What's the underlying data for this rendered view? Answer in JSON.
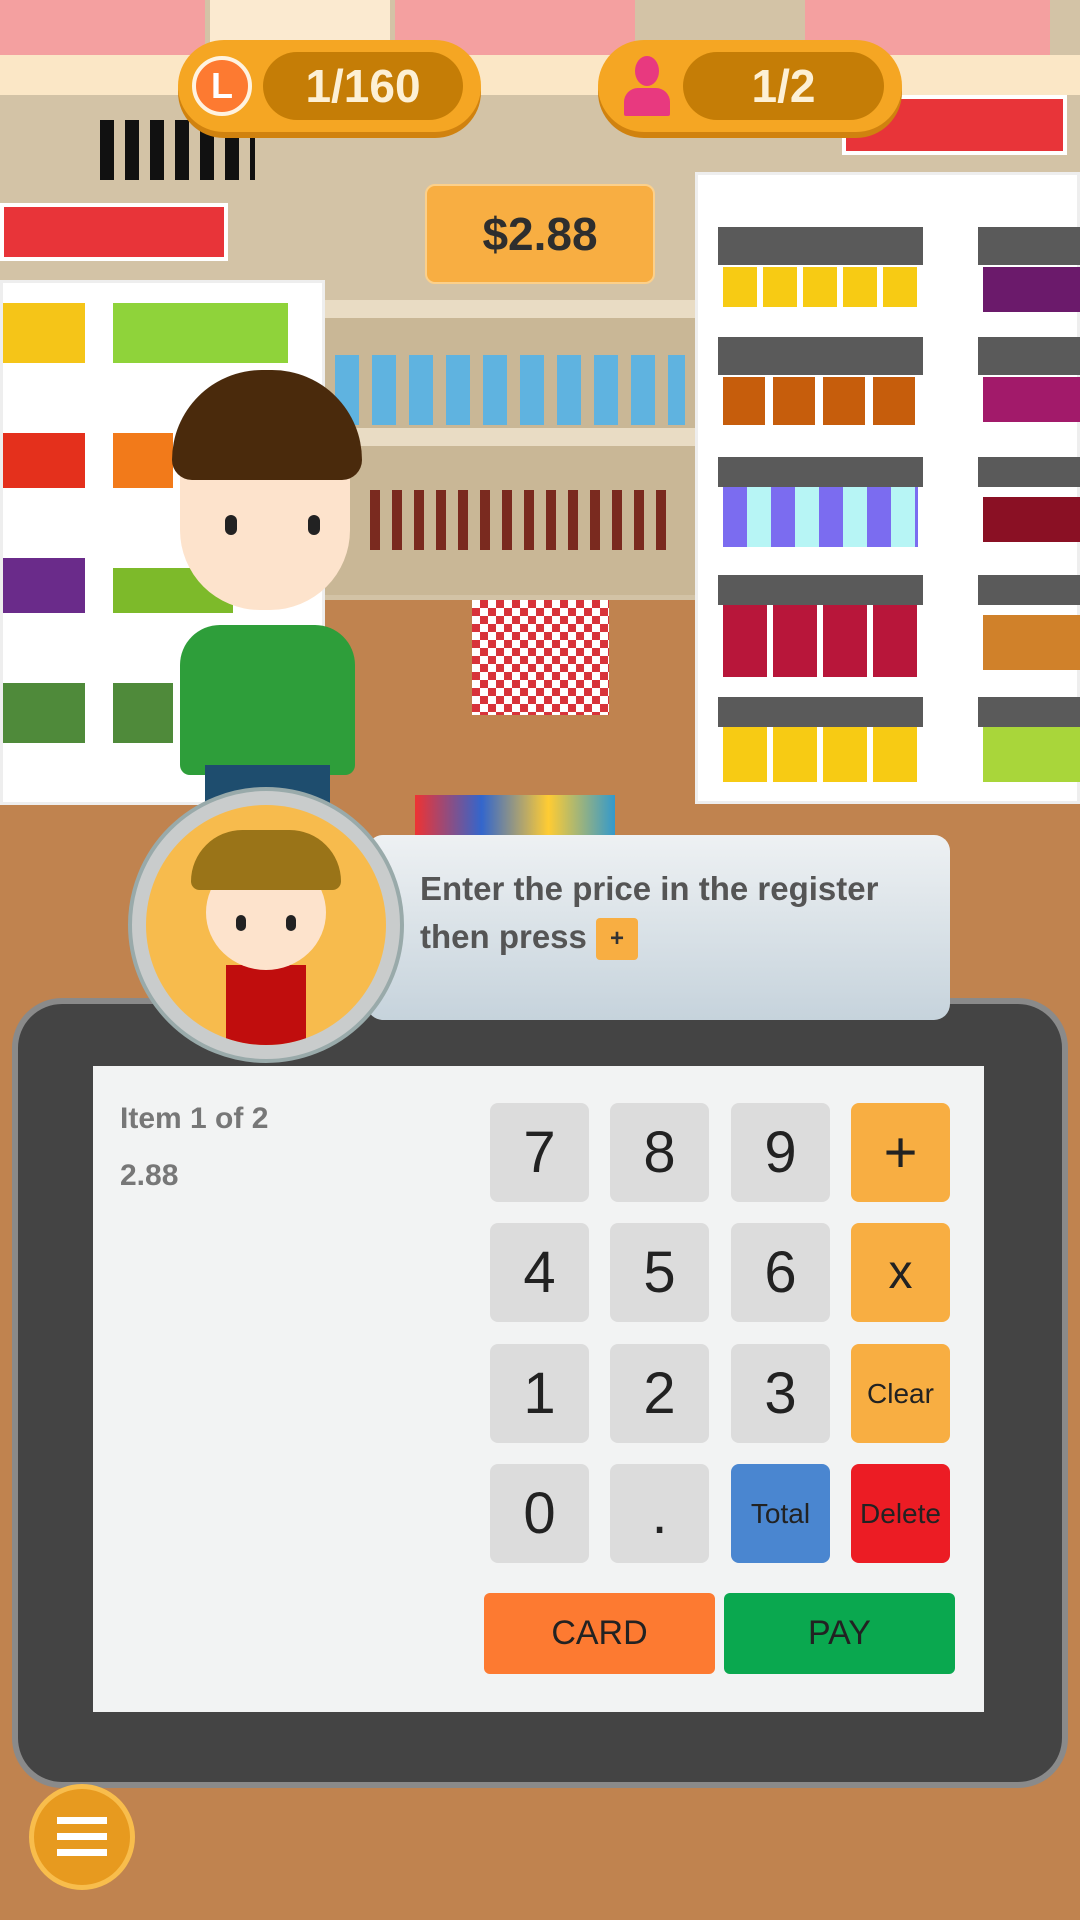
{
  "hud": {
    "level": {
      "icon": "level-L-icon",
      "letter": "L",
      "value": "1/160"
    },
    "customers": {
      "icon": "customer-person-icon",
      "value": "1/2"
    }
  },
  "price_tag": "$2.88",
  "instruction": {
    "text": "Enter the price in the register then press",
    "inline_key": "+"
  },
  "register": {
    "item_label": "Item 1 of 2",
    "entered_value": "2.88",
    "keys": [
      [
        "7",
        "8",
        "9",
        "+"
      ],
      [
        "4",
        "5",
        "6",
        "x"
      ],
      [
        "1",
        "2",
        "3",
        "Clear"
      ],
      [
        "0",
        ".",
        "Total",
        "Delete"
      ]
    ],
    "card_label": "CARD",
    "pay_label": "PAY"
  },
  "menu_icon": "list-menu-icon",
  "colors": {
    "accent": "#f8ae42",
    "total": "#4a86d0",
    "delete": "#ec1c24",
    "card": "#fd7a31",
    "pay": "#0aa84f",
    "floor": "#c0834f"
  }
}
